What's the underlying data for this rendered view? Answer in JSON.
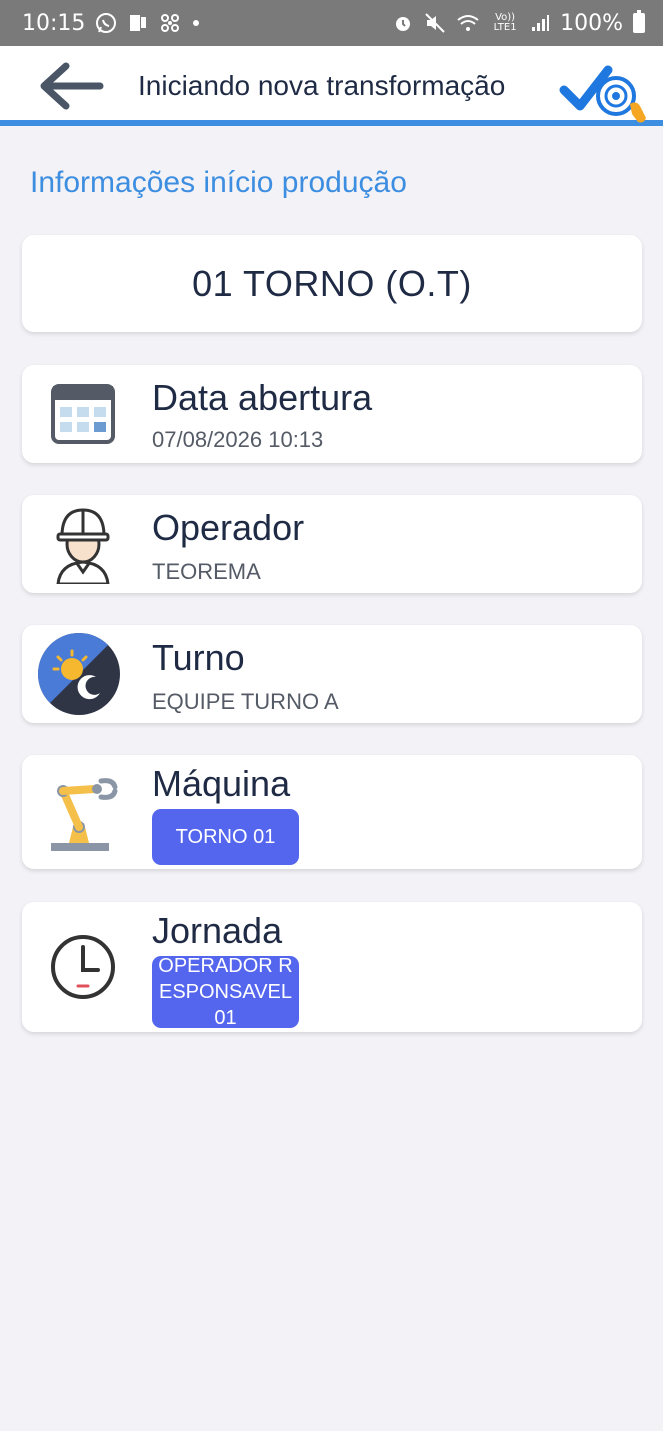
{
  "status_bar": {
    "time": "10:15",
    "battery": "100%",
    "icons_left": [
      "whatsapp-icon",
      "notification-icon",
      "fan-icon",
      "dot-icon"
    ],
    "icons_right": [
      "alarm-icon",
      "mute-icon",
      "wifi-icon",
      "volte-icon",
      "signal-icon",
      "battery-icon"
    ],
    "volte_label": "Vo)) LTE1"
  },
  "header": {
    "title": "Iniciando nova transformação",
    "accent_color": "#3d8ee0"
  },
  "section_title": "Informações início produção",
  "order": {
    "label": "01 TORNO (O.T)"
  },
  "cards": {
    "date": {
      "label": "Data abertura",
      "value": "07/08/2026 10:13",
      "icon": "calendar-icon"
    },
    "operator": {
      "label": "Operador",
      "value": "TEOREMA",
      "icon": "worker-helmet-icon"
    },
    "shift": {
      "label": "Turno",
      "value": "EQUIPE TURNO A",
      "icon": "day-night-icon"
    },
    "machine": {
      "label": "Máquina",
      "value": "TORNO 01",
      "icon": "robot-arm-icon"
    },
    "journey": {
      "label": "Jornada",
      "value": "OPERADOR RESPONSAVEL 01",
      "icon": "clock-icon"
    }
  },
  "colors": {
    "chip": "#5566ee",
    "background": "#f2f2f7",
    "status_bar": "#7a7a7a"
  }
}
